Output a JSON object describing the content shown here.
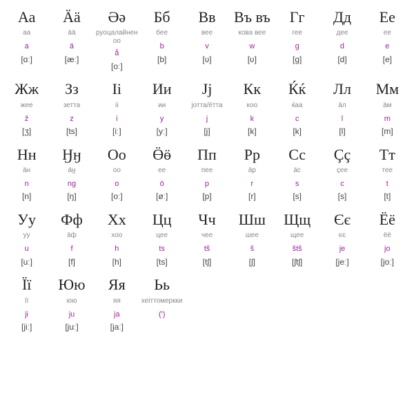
{
  "alphabet": [
    {
      "letter": "Аа",
      "name": "аа",
      "translit": "a",
      "ipa": "[ɑː]"
    },
    {
      "letter": "Ӓӓ",
      "name": "ӓӓ",
      "translit": "ä",
      "ipa": "[æː]"
    },
    {
      "letter": "Әә",
      "name": "руоцалайнен оо",
      "translit": "å",
      "ipa": "[oː]"
    },
    {
      "letter": "Бб",
      "name": "бее",
      "translit": "b",
      "ipa": "[b]"
    },
    {
      "letter": "Вв",
      "name": "вее",
      "translit": "v",
      "ipa": "[ʋ]"
    },
    {
      "letter": "Въ въ",
      "name": "кова вее",
      "translit": "w",
      "ipa": "[ʋ]"
    },
    {
      "letter": "Гг",
      "name": "гее",
      "translit": "g",
      "ipa": "[g]"
    },
    {
      "letter": "Дд",
      "name": "дее",
      "translit": "d",
      "ipa": "[d]"
    },
    {
      "letter": "Ее",
      "name": "ее",
      "translit": "e",
      "ipa": "[e]"
    },
    {
      "letter": "Жж",
      "name": "жее",
      "translit": "ž",
      "ipa": "[ʒ]"
    },
    {
      "letter": "Зз",
      "name": "зетта",
      "translit": "z",
      "ipa": "[ts]"
    },
    {
      "letter": "Іі",
      "name": "іі",
      "translit": "i",
      "ipa": "[iː]"
    },
    {
      "letter": "Ии",
      "name": "ии",
      "translit": "y",
      "ipa": "[yː]"
    },
    {
      "letter": "Јј",
      "name": "јотта/ётта",
      "translit": "j",
      "ipa": "[j]"
    },
    {
      "letter": "Кк",
      "name": "коо",
      "translit": "k",
      "ipa": "[k]"
    },
    {
      "letter": "Ќќ",
      "name": "ќаа",
      "translit": "c",
      "ipa": "[k]"
    },
    {
      "letter": "Лл",
      "name": "ӓл",
      "translit": "l",
      "ipa": "[l]"
    },
    {
      "letter": "Мм",
      "name": "ӓм",
      "translit": "m",
      "ipa": "[m]"
    },
    {
      "letter": "Нн",
      "name": "ӓн",
      "translit": "n",
      "ipa": "[n]"
    },
    {
      "letter": "Ӈӈ",
      "name": "ӓӈ",
      "translit": "ng",
      "ipa": "[ŋ]"
    },
    {
      "letter": "Оо",
      "name": "оо",
      "translit": "o",
      "ipa": "[oː]"
    },
    {
      "letter": "Ӫӫ",
      "name": "ее",
      "translit": "ö",
      "ipa": "[øː]"
    },
    {
      "letter": "Пп",
      "name": "пее",
      "translit": "p",
      "ipa": "[p]"
    },
    {
      "letter": "Рр",
      "name": "ӓр",
      "translit": "r",
      "ipa": "[r]"
    },
    {
      "letter": "Сс",
      "name": "ӓс",
      "translit": "s",
      "ipa": "[s]"
    },
    {
      "letter": "Çç",
      "name": "çее",
      "translit": "c",
      "ipa": "[s]"
    },
    {
      "letter": "Тт",
      "name": "тее",
      "translit": "t",
      "ipa": "[t]"
    },
    {
      "letter": "Уу",
      "name": "уу",
      "translit": "u",
      "ipa": "[uː]"
    },
    {
      "letter": "Фф",
      "name": "ӓф",
      "translit": "f",
      "ipa": "[f]"
    },
    {
      "letter": "Хх",
      "name": "хоо",
      "translit": "h",
      "ipa": "[h]"
    },
    {
      "letter": "Цц",
      "name": "цее",
      "translit": "ts",
      "ipa": "[ts]"
    },
    {
      "letter": "Чч",
      "name": "чее",
      "translit": "tš",
      "ipa": "[tʃ]"
    },
    {
      "letter": "Шш",
      "name": "шее",
      "translit": "š",
      "ipa": "[ʃ]"
    },
    {
      "letter": "Щщ",
      "name": "щее",
      "translit": "štš",
      "ipa": "[ʃtʃ]"
    },
    {
      "letter": "Єє",
      "name": "єє",
      "translit": "je",
      "ipa": "[jeː]"
    },
    {
      "letter": "Ёё",
      "name": "ёё",
      "translit": "jo",
      "ipa": "[joː]"
    },
    {
      "letter": "Її",
      "name": "її",
      "translit": "ji",
      "ipa": "[jiː]"
    },
    {
      "letter": "Юю",
      "name": "юю",
      "translit": "ju",
      "ipa": "[juː]"
    },
    {
      "letter": "Яя",
      "name": "яя",
      "translit": "ja",
      "ipa": "[jaː]"
    },
    {
      "letter": "Ьь",
      "name": "хеіттомеркки",
      "translit": "(')",
      "ipa": ""
    }
  ]
}
